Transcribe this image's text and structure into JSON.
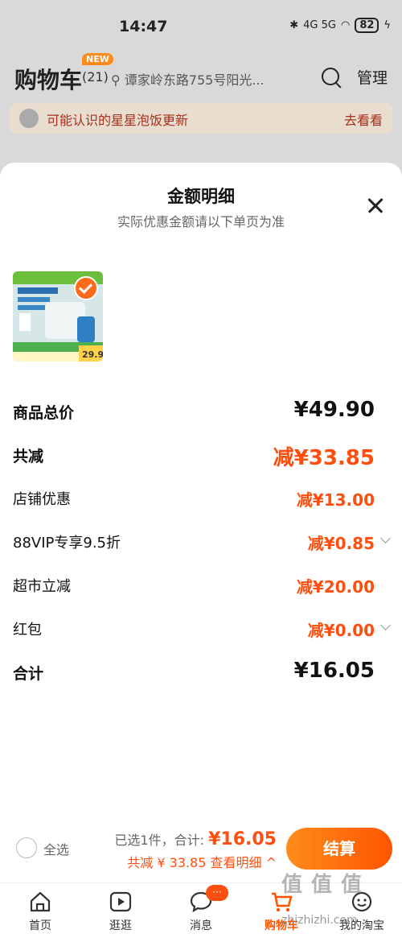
{
  "status_bar": {
    "time": "14:47",
    "network": "4G 5G",
    "battery": "82"
  },
  "header": {
    "title": "购物车",
    "count": "(21)",
    "badge": "NEW",
    "address": "谭家岭东路755号阳光...",
    "manage_label": "管理"
  },
  "notice": {
    "text": "可能认识的星星泡饭更新",
    "link": "去看看"
  },
  "sheet": {
    "title": "金额明细",
    "subtitle": "实际优惠金额请以下单页为准",
    "thumb_price": "29.9",
    "rows": [
      {
        "label": "商品总价",
        "value": "¥49.90"
      },
      {
        "label": "共减",
        "value": "减¥33.85"
      },
      {
        "label": "店铺优惠",
        "value": "减¥13.00"
      },
      {
        "label": "88VIP专享9.5折",
        "value": "减¥0.85"
      },
      {
        "label": "超市立减",
        "value": "减¥20.00"
      },
      {
        "label": "红包",
        "value": "减¥0.00"
      },
      {
        "label": "合计",
        "value": "¥16.05"
      }
    ]
  },
  "checkout": {
    "select_all": "全选",
    "selected_text": "已选1件，合计:",
    "total": "¥16.05",
    "discount_text": "共减 ¥ 33.85  查看明细 ^",
    "pay_button": "结算"
  },
  "tabs": [
    {
      "label": "首页",
      "icon": "home-icon"
    },
    {
      "label": "逛逛",
      "icon": "play-icon"
    },
    {
      "label": "消息",
      "icon": "message-icon",
      "badge": "···"
    },
    {
      "label": "购物车",
      "icon": "cart-icon",
      "active": true
    },
    {
      "label": "我的淘宝",
      "icon": "profile-icon"
    }
  ],
  "watermark": {
    "brand": "值 值 值",
    "site": "zhizhizhi.com"
  },
  "colors": {
    "accent": "#ff5500",
    "discount": "#ff4f0e"
  }
}
